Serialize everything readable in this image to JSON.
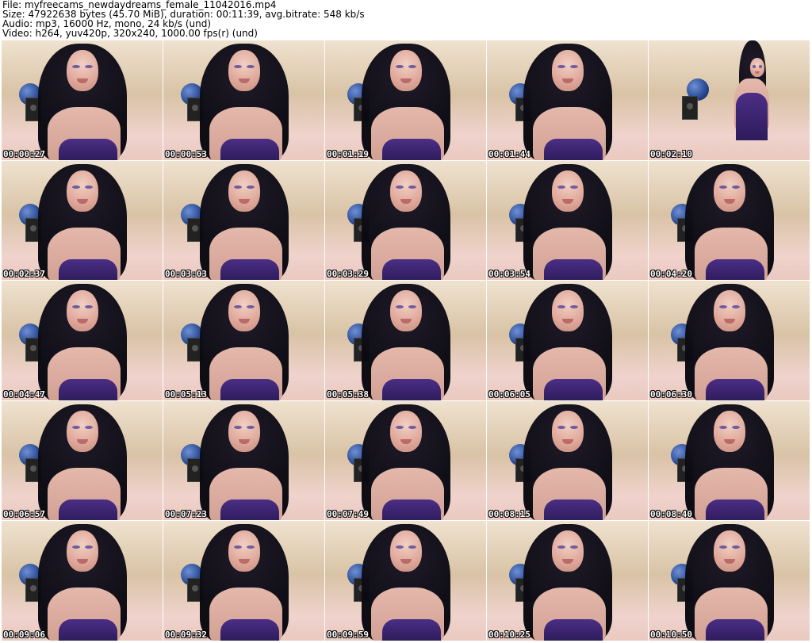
{
  "header": {
    "file_line": "File: myfreecams_newdaydreams_female_11042016.mp4",
    "size_line": "Size: 47922638 bytes (45.70 MiB), duration: 00:11:39, avg.bitrate: 548 kb/s",
    "audio_line": "Audio: mp3, 16000 Hz, mono, 24 kb/s (und)",
    "video_line": "Video: h264, yuv420p, 320x240, 1000.00 fps(r) (und)"
  },
  "thumbnails": [
    {
      "time": "00:00:27"
    },
    {
      "time": "00:00:53"
    },
    {
      "time": "00:01:19"
    },
    {
      "time": "00:01:44"
    },
    {
      "time": "00:02:10"
    },
    {
      "time": "00:02:37"
    },
    {
      "time": "00:03:03"
    },
    {
      "time": "00:03:29"
    },
    {
      "time": "00:03:54"
    },
    {
      "time": "00:04:20"
    },
    {
      "time": "00:04:47"
    },
    {
      "time": "00:05:13"
    },
    {
      "time": "00:05:38"
    },
    {
      "time": "00:06:05"
    },
    {
      "time": "00:06:30"
    },
    {
      "time": "00:06:57"
    },
    {
      "time": "00:07:23"
    },
    {
      "time": "00:07:49"
    },
    {
      "time": "00:08:15"
    },
    {
      "time": "00:08:40"
    },
    {
      "time": "00:09:06"
    },
    {
      "time": "00:09:32"
    },
    {
      "time": "00:09:59"
    },
    {
      "time": "00:10:25"
    },
    {
      "time": "00:10:50"
    }
  ]
}
